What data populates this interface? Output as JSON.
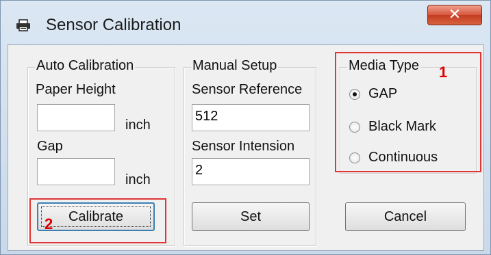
{
  "window": {
    "title": "Sensor Calibration",
    "close_glyph": "✕"
  },
  "auto_calibration": {
    "legend": "Auto Calibration",
    "paper_height_label": "Paper Height",
    "paper_height_value": "",
    "gap_label": "Gap",
    "gap_value": "",
    "unit_inch": "inch",
    "calibrate_label": "Calibrate"
  },
  "manual_setup": {
    "legend": "Manual Setup",
    "sensor_reference_label": "Sensor Reference",
    "sensor_reference_value": "512",
    "sensor_intension_label": "Sensor Intension",
    "sensor_intension_value": "2",
    "set_label": "Set"
  },
  "media_type": {
    "legend": "Media Type",
    "options": [
      {
        "label": "GAP",
        "selected": true
      },
      {
        "label": "Black Mark",
        "selected": false
      },
      {
        "label": "Continuous",
        "selected": false
      }
    ]
  },
  "cancel_label": "Cancel",
  "annotations": {
    "n1": "1",
    "n2": "2",
    "color": "#e03535"
  }
}
